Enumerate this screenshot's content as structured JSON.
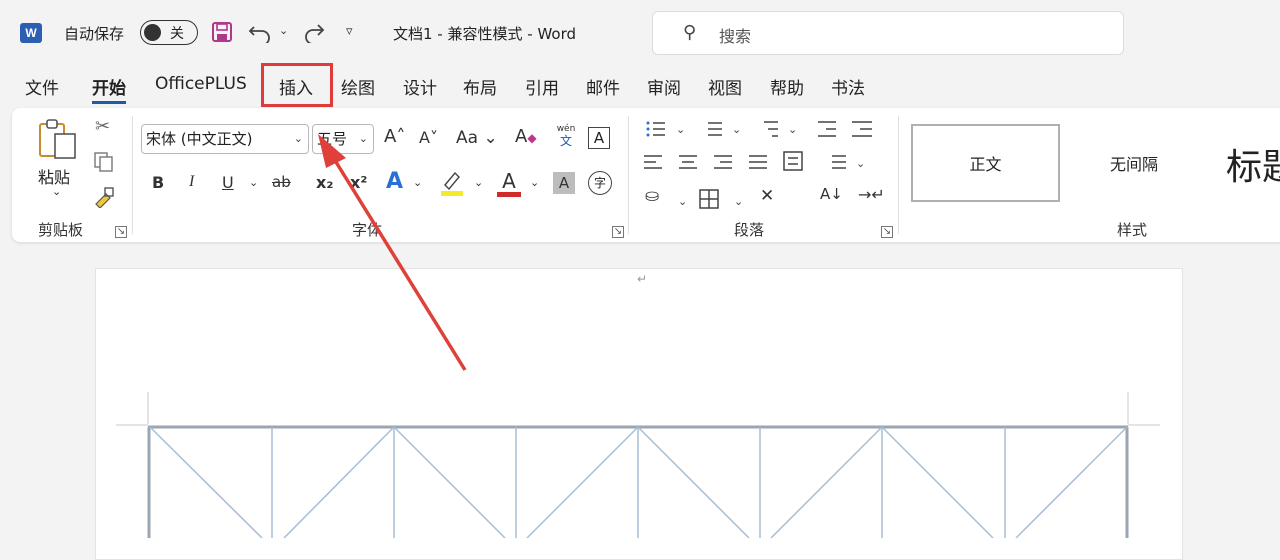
{
  "titlebar": {
    "autosave_label": "自动保存",
    "autosave_state": "关",
    "document_title": "文档1 - 兼容性模式 - Word",
    "search_placeholder": "搜索"
  },
  "menu": {
    "tabs": [
      "文件",
      "开始",
      "OfficePLUS",
      "插入",
      "绘图",
      "设计",
      "布局",
      "引用",
      "邮件",
      "审阅",
      "视图",
      "帮助",
      "书法"
    ],
    "active_tab": "开始",
    "highlighted_tab": "插入"
  },
  "ribbon": {
    "clipboard": {
      "paste_label": "粘贴",
      "group_label": "剪贴板"
    },
    "font": {
      "font_name": "宋体 (中文正文)",
      "font_size": "五号",
      "aa_label": "Aa",
      "phonetic_top": "wén",
      "phonetic_bottom": "文",
      "bold": "B",
      "italic": "I",
      "underline": "U",
      "strike": "ab",
      "subscript": "x₂",
      "superscript": "x²",
      "char_border": "A",
      "char_shading": "A",
      "enclose_char": "字",
      "group_label": "字体"
    },
    "paragraph": {
      "group_label": "段落"
    },
    "styles": {
      "items": [
        "正文",
        "无间隔",
        "标题"
      ],
      "group_label": "样式"
    }
  },
  "document": {
    "paragraph_mark": "↵"
  },
  "colors": {
    "accent": "#1e5aa8",
    "highlight_box": "#e03a3a",
    "arrow": "#e0403a",
    "table_line": "#9aabbd"
  }
}
